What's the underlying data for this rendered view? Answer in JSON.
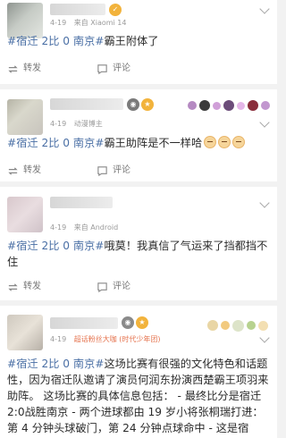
{
  "posts": [
    {
      "time": "4-19",
      "source": "来自 Xiaomi 14",
      "topic": "#宿迁 2比 0 南京#",
      "text": "霸王附体了",
      "actions": {
        "repost": "转发",
        "comment": "评论"
      }
    },
    {
      "time": "4-19",
      "source": "动漫博主",
      "topic": "#宿迁 2比 0 南京#",
      "text": "霸王助阵是不一样哈",
      "actions": {
        "repost": "转发",
        "comment": "评论"
      }
    },
    {
      "time": "4-19",
      "source": "来自 Android",
      "topic": "#宿迁 2比 0 南京#",
      "text": "哦莫！我真信了气运来了挡都挡不住",
      "actions": {
        "repost": "转发",
        "comment": "评论"
      }
    },
    {
      "time": "4-19",
      "source": "超话粉丝大咖 (时代少年团)",
      "topic": "#宿迁 2比 0 南京#",
      "text": "这场比赛有很强的文化特色和话题性，因为宿迁队邀请了演员何润东扮演西楚霸王项羽来助阵。 这场比赛的具体信息包括： - 最终比分是宿迁2:0战胜南京 - 两个进球都由 19 岁小将张桐瑞打进：第 4 分钟头球破门，第 24 分钟点球命中 - 这是宿"
    }
  ],
  "colors": {
    "topic": "#4a6fa5",
    "vip_source": "#e5734e",
    "meta": "#9a9a9a"
  },
  "icons": {
    "repost": "repost-icon",
    "comment": "comment-icon",
    "more": "chevron-down-icon"
  }
}
